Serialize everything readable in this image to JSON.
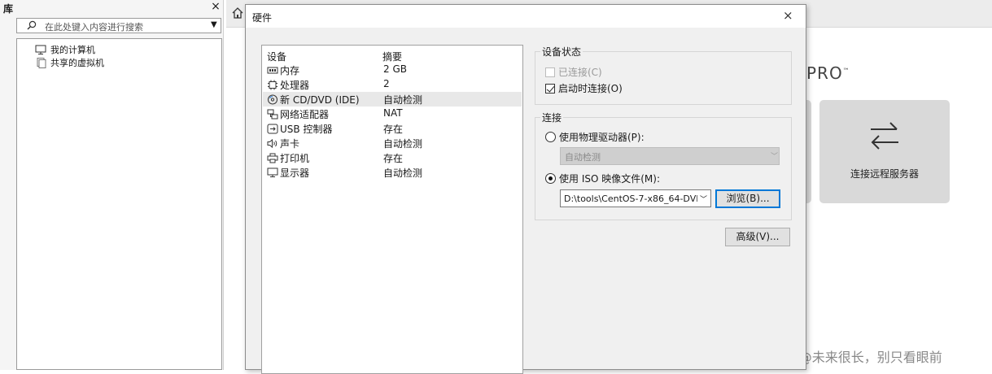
{
  "library": {
    "title": "库",
    "close": "×",
    "search_placeholder": "在此处键入内容进行搜索",
    "dropdown": "▼",
    "tree": [
      {
        "label": "我的计算机",
        "icon": "monitor-icon"
      },
      {
        "label": "共享的虚拟机",
        "icon": "shared-vm-icon"
      }
    ]
  },
  "home": {
    "brand": "PRO",
    "trademark": "™",
    "remote_card_label": "连接远程服务器",
    "watermark": "CSDN @未来很长，别只看眼前"
  },
  "dialog": {
    "title": "硬件",
    "close": "×",
    "columns": {
      "device": "设备",
      "summary": "摘要"
    },
    "devices": [
      {
        "name": "内存",
        "summary": "2 GB",
        "icon": "memory-icon"
      },
      {
        "name": "处理器",
        "summary": "2",
        "icon": "cpu-icon"
      },
      {
        "name": "新 CD/DVD (IDE)",
        "summary": "自动检测",
        "icon": "cd-icon",
        "selected": true
      },
      {
        "name": "网络适配器",
        "summary": "NAT",
        "icon": "network-icon"
      },
      {
        "name": "USB 控制器",
        "summary": "存在",
        "icon": "usb-icon"
      },
      {
        "name": "声卡",
        "summary": "自动检测",
        "icon": "sound-icon"
      },
      {
        "name": "打印机",
        "summary": "存在",
        "icon": "printer-icon"
      },
      {
        "name": "显示器",
        "summary": "自动检测",
        "icon": "display-icon"
      }
    ],
    "device_status": {
      "title": "设备状态",
      "connected": "已连接(C)",
      "connect_at_power_on": "启动时连接(O)"
    },
    "connection": {
      "title": "连接",
      "use_physical": "使用物理驱动器(P):",
      "physical_value": "自动检测",
      "use_iso": "使用 ISO 映像文件(M):",
      "iso_value": "D:\\tools\\CentOS-7-x86_64-DVI",
      "browse": "浏览(B)..."
    },
    "advanced": "高级(V)..."
  }
}
